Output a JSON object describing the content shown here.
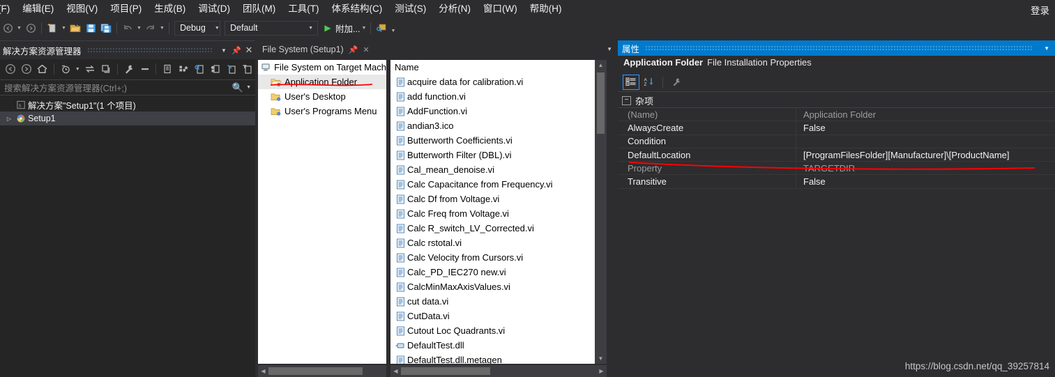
{
  "menubar": {
    "items": [
      {
        "label": "(F)"
      },
      {
        "label": "编辑(E)"
      },
      {
        "label": "视图(V)"
      },
      {
        "label": "项目(P)"
      },
      {
        "label": "生成(B)"
      },
      {
        "label": "调试(D)"
      },
      {
        "label": "团队(M)"
      },
      {
        "label": "工具(T)"
      },
      {
        "label": "体系结构(C)"
      },
      {
        "label": "测试(S)"
      },
      {
        "label": "分析(N)"
      },
      {
        "label": "窗口(W)"
      },
      {
        "label": "帮助(H)"
      }
    ],
    "login_label": "登录"
  },
  "toolbar": {
    "config_combo": "Debug",
    "platform_combo": "Default",
    "attach_label": "附加...",
    "icons": [
      "navigate-back-icon",
      "navigate-forward-icon",
      "new-project-icon",
      "open-file-icon",
      "save-icon",
      "save-all-icon",
      "undo-icon",
      "redo-icon",
      "start-debug-icon",
      "attach-process-icon"
    ]
  },
  "solution_explorer": {
    "title": "解决方案资源管理器",
    "search_placeholder": "搜索解决方案资源管理器(Ctrl+;)",
    "tree": [
      {
        "label": "解决方案\"Setup1\"(1 个项目)",
        "icon": "solution-icon",
        "selected": false,
        "expander": ""
      },
      {
        "label": "Setup1",
        "icon": "setup-project-icon",
        "selected": true,
        "expander": "▷"
      }
    ]
  },
  "file_system_editor": {
    "tab_label": "File System (Setup1)",
    "tree": [
      {
        "label": "File System on Target Mach",
        "icon": "computer-icon",
        "indent": false,
        "selected": false
      },
      {
        "label": "Application Folder",
        "icon": "open-folder-icon",
        "indent": true,
        "selected": true
      },
      {
        "label": "User's Desktop",
        "icon": "folder-icon",
        "indent": true,
        "selected": false
      },
      {
        "label": "User's Programs Menu",
        "icon": "folder-icon",
        "indent": true,
        "selected": false
      }
    ],
    "column_header": "Name",
    "files": [
      {
        "name": "acquire data for calibration.vi",
        "icon": "vi-file-icon"
      },
      {
        "name": "add function.vi",
        "icon": "vi-file-icon"
      },
      {
        "name": "AddFunction.vi",
        "icon": "vi-file-icon"
      },
      {
        "name": "andian3.ico",
        "icon": "vi-file-icon"
      },
      {
        "name": "Butterworth Coefficients.vi",
        "icon": "vi-file-icon"
      },
      {
        "name": "Butterworth Filter (DBL).vi",
        "icon": "vi-file-icon"
      },
      {
        "name": "Cal_mean_denoise.vi",
        "icon": "vi-file-icon"
      },
      {
        "name": "Calc Capacitance from Frequency.vi",
        "icon": "vi-file-icon"
      },
      {
        "name": "Calc Df from Voltage.vi",
        "icon": "vi-file-icon"
      },
      {
        "name": "Calc Freq from Voltage.vi",
        "icon": "vi-file-icon"
      },
      {
        "name": "Calc R_switch_LV_Corrected.vi",
        "icon": "vi-file-icon"
      },
      {
        "name": "Calc rstotal.vi",
        "icon": "vi-file-icon"
      },
      {
        "name": "Calc Velocity from Cursors.vi",
        "icon": "vi-file-icon"
      },
      {
        "name": "Calc_PD_IEC270 new.vi",
        "icon": "vi-file-icon"
      },
      {
        "name": "CalcMinMaxAxisValues.vi",
        "icon": "vi-file-icon"
      },
      {
        "name": "cut data.vi",
        "icon": "vi-file-icon"
      },
      {
        "name": "CutData.vi",
        "icon": "vi-file-icon"
      },
      {
        "name": "Cutout Loc Quadrants.vi",
        "icon": "vi-file-icon"
      },
      {
        "name": "DefaultTest.dll",
        "icon": "dll-file-icon"
      },
      {
        "name": "DefaultTest.dll.metagen",
        "icon": "vi-file-icon"
      }
    ]
  },
  "properties": {
    "title": "属性",
    "subject": "Application Folder",
    "subject_kind": "File Installation Properties",
    "category_label": "杂项",
    "toolbar_icons": [
      "categorized-view-icon",
      "alphabetical-sort-icon",
      "property-pages-icon"
    ],
    "rows": [
      {
        "key": "(Name)",
        "value": "Application Folder",
        "dim": true
      },
      {
        "key": "AlwaysCreate",
        "value": "False",
        "dim": false
      },
      {
        "key": "Condition",
        "value": "",
        "dim": false
      },
      {
        "key": "DefaultLocation",
        "value": "[ProgramFilesFolder][Manufacturer]\\[ProductName]",
        "dim": false
      },
      {
        "key": "Property",
        "value": "TARGETDIR",
        "dim": true
      },
      {
        "key": "Transitive",
        "value": "False",
        "dim": false
      }
    ]
  },
  "watermark": "https://blog.csdn.net/qq_39257814",
  "colors": {
    "accent_blue": "#007acc",
    "annotation_red": "#ff0000",
    "chrome_bg": "#2d2d30",
    "panel_bg": "#252526"
  }
}
